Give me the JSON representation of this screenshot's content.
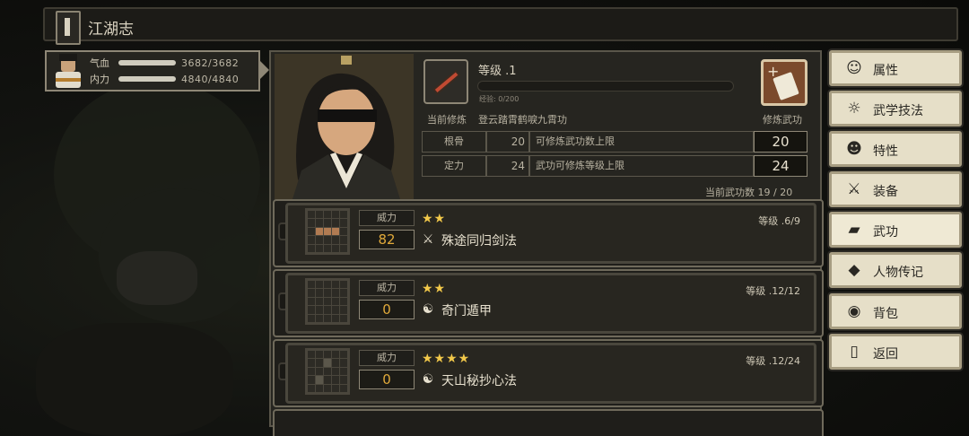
{
  "header": {
    "title": "江湖志",
    "book_icon": "book-icon"
  },
  "player": {
    "hp_label": "气血",
    "hp_value": "3682/3682",
    "hp_fraction": 1.0,
    "mp_label": "内力",
    "mp_value": "4840/4840",
    "mp_fraction": 1.0
  },
  "skill_panel": {
    "level_label": "等级 .1",
    "exp_text": "经验: 0/200",
    "exp_fraction": 0.0,
    "current_label": "当前修炼",
    "current_name": "登云踏霄鹤唳九霄功",
    "train_label": "修炼武功",
    "attributes": [
      {
        "name": "根骨",
        "value": "20",
        "desc": "可修炼武功数上限",
        "big": "20"
      },
      {
        "name": "定力",
        "value": "24",
        "desc": "武功可修炼等级上限",
        "big": "24"
      }
    ],
    "martial_count": "当前武功数  19 / 20"
  },
  "skills": [
    {
      "power_label": "威力",
      "power": "82",
      "stars": "★★",
      "icon": "sword-icon",
      "icon_glyph": "⚔",
      "name": "殊途同归剑法",
      "level": "等级 .6/9"
    },
    {
      "power_label": "威力",
      "power": "0",
      "stars": "★★",
      "icon": "yinyang-icon",
      "icon_glyph": "☯",
      "name": "奇门遁甲",
      "level": "等级 .12/12"
    },
    {
      "power_label": "威力",
      "power": "0",
      "stars": "★★★★",
      "icon": "yinyang-icon",
      "icon_glyph": "☯",
      "name": "天山秘抄心法",
      "level": "等级 .12/24"
    }
  ],
  "menu": [
    {
      "label": "属性",
      "icon": "person-icon",
      "glyph": "☺"
    },
    {
      "label": "武学技法",
      "icon": "idea-person-icon",
      "glyph": "☼"
    },
    {
      "label": "特性",
      "icon": "person-trait-icon",
      "glyph": "☻"
    },
    {
      "label": "装备",
      "icon": "sword-icon",
      "glyph": "⚔"
    },
    {
      "label": "武功",
      "icon": "book-icon",
      "glyph": "▰"
    },
    {
      "label": "人物传记",
      "icon": "scroll-icon",
      "glyph": "◆"
    },
    {
      "label": "背包",
      "icon": "bag-icon",
      "glyph": "◉"
    },
    {
      "label": "返回",
      "icon": "door-icon",
      "glyph": "▯"
    }
  ],
  "colors": {
    "power_number": "#e0a93a",
    "star": "#f2c84a",
    "menu_bg": "#e6dfc8",
    "train_button": "#7b4a2c"
  }
}
